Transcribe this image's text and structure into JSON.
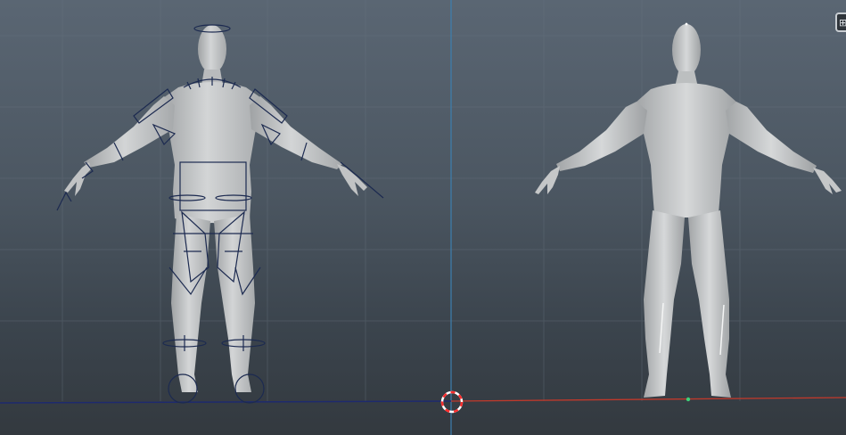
{
  "viewport": {
    "background_top": "#5a6673",
    "background_bottom": "#33393f",
    "grid_color": "#6a7682",
    "x_axis_color": "#c0392b",
    "z_axis_color": "#1e2a6e",
    "y_axis_color": "#3d7fb0",
    "mesh_color": "#c9cbcc"
  },
  "models": [
    {
      "name": "rigged-character",
      "has_skeleton_controls": true,
      "control_color": "#1c2a50"
    },
    {
      "name": "character-mesh",
      "has_skeleton_controls": false
    }
  ],
  "origin_manipulator": {
    "icon": "target-circle-icon",
    "colors": [
      "#ff2d2d",
      "#ffffff"
    ]
  },
  "toolbar": {
    "icon": "panel-layout-icon"
  }
}
